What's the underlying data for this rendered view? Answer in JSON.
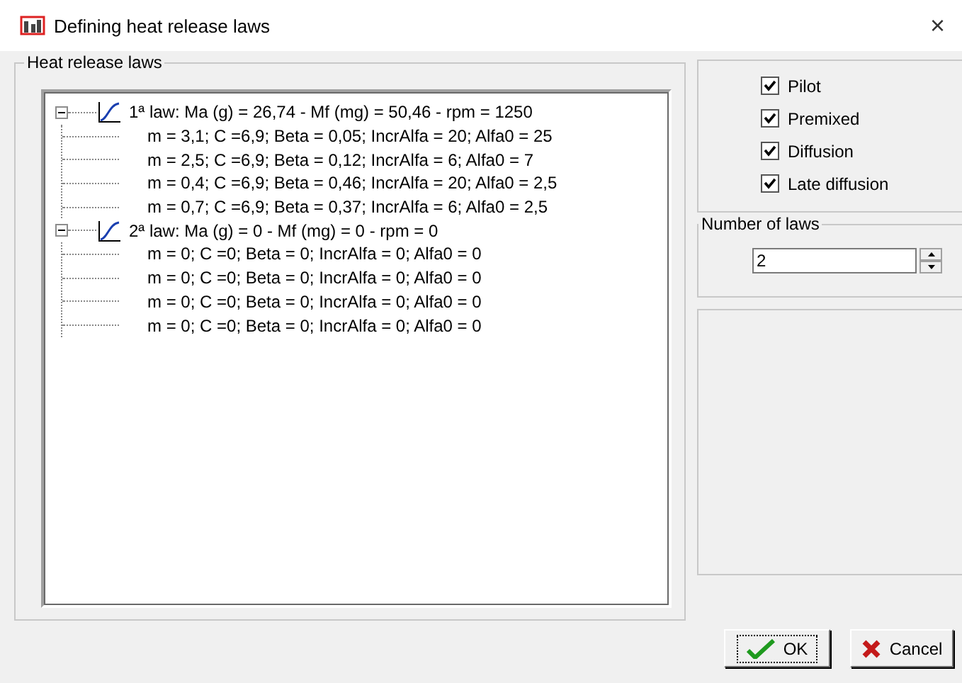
{
  "window": {
    "title": "Defining heat release laws",
    "close": "×"
  },
  "heat_release_laws": {
    "title": "Heat release laws",
    "tree": [
      {
        "text": "1ª law: Ma (g)  = 26,74 - Mf (mg)  = 50,46 - rpm = 1250",
        "expanded": true,
        "children": [
          {
            "text": "m = 3,1; C =6,9; Beta = 0,05; IncrAlfa = 20; Alfa0 = 25"
          },
          {
            "text": "m = 2,5; C =6,9; Beta = 0,12; IncrAlfa = 6; Alfa0 = 7"
          },
          {
            "text": "m = 0,4; C =6,9; Beta = 0,46; IncrAlfa = 20; Alfa0 = 2,5"
          },
          {
            "text": "m = 0,7; C =6,9; Beta = 0,37; IncrAlfa = 6; Alfa0 = 2,5"
          }
        ]
      },
      {
        "text": "2ª law: Ma (g)  = 0 - Mf (mg)  = 0 - rpm = 0",
        "expanded": true,
        "children": [
          {
            "text": "m = 0; C =0; Beta = 0; IncrAlfa = 0; Alfa0 = 0"
          },
          {
            "text": "m = 0; C =0; Beta = 0; IncrAlfa = 0; Alfa0 = 0"
          },
          {
            "text": "m = 0; C =0; Beta = 0; IncrAlfa = 0; Alfa0 = 0"
          },
          {
            "text": "m = 0; C =0; Beta = 0; IncrAlfa = 0; Alfa0 = 0"
          }
        ]
      }
    ]
  },
  "combustion_phases": [
    {
      "label": "Pilot",
      "checked": true
    },
    {
      "label": "Premixed",
      "checked": true
    },
    {
      "label": "Diffusion",
      "checked": true
    },
    {
      "label": "Late diffusion",
      "checked": true
    }
  ],
  "number_of_laws": {
    "title": "Number of laws",
    "value": "2"
  },
  "buttons": [
    {
      "kind": "ok",
      "label": "OK",
      "focused": true
    },
    {
      "kind": "cancel",
      "label": "Cancel",
      "focused": false
    }
  ]
}
